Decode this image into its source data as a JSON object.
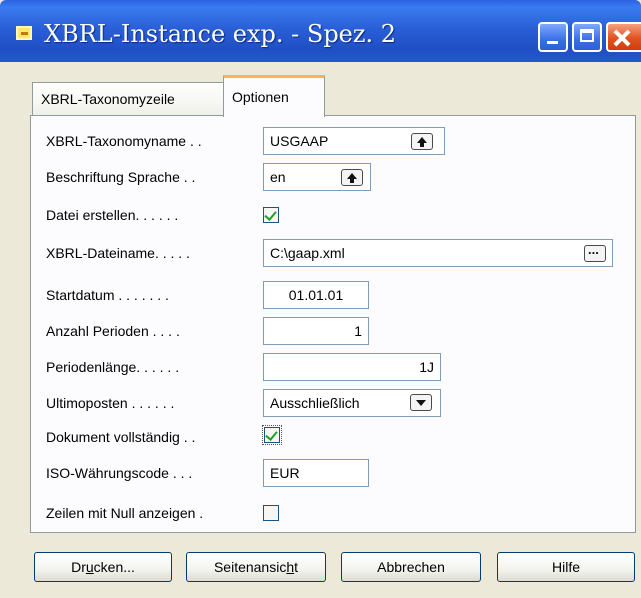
{
  "window": {
    "title": "XBRL-Instance exp. - Spez. 2"
  },
  "tabs": [
    {
      "label": "XBRL-Taxonomyzeile"
    },
    {
      "label": "Optionen"
    }
  ],
  "fields": {
    "taxonomyname": {
      "label": "XBRL-Taxonomyname . .",
      "value": "USGAAP"
    },
    "sprache": {
      "label": "Beschriftung Sprache . .",
      "value": "en"
    },
    "datei_erstellen": {
      "label": "Datei erstellen. . . . . .",
      "checked": true
    },
    "dateiname": {
      "label": "XBRL-Dateiname. . . . .",
      "value": "C:\\gaap.xml"
    },
    "startdatum": {
      "label": "Startdatum . . . . . . .",
      "value": "01.01.01"
    },
    "anzahl_perioden": {
      "label": "Anzahl Perioden . . . .",
      "value": "1"
    },
    "periodenlaenge": {
      "label": "Periodenlänge. . . . . .",
      "value": "1J"
    },
    "ultimoposten": {
      "label": "Ultimoposten . . . . . .",
      "value": "Ausschließlich"
    },
    "dokument_vollstaendig": {
      "label": "Dokument vollständig . .",
      "checked": true
    },
    "iso_waehrungscode": {
      "label": "ISO-Währungscode . . .",
      "value": "EUR"
    },
    "zeilen_null": {
      "label": "Zeilen mit Null anzeigen .",
      "checked": false
    }
  },
  "buttons": {
    "drucken_pre": "Dr",
    "drucken_ul": "u",
    "drucken_post": "cken...",
    "seitenansicht_pre": "Seitenansic",
    "seitenansicht_ul": "h",
    "seitenansicht_post": "t",
    "abbrechen": "Abbrechen",
    "hilfe": "Hilfe"
  },
  "colors": {
    "titlebar": "#245edc",
    "tab_highlight": "#f7b54a",
    "checkmark": "#21a121"
  }
}
